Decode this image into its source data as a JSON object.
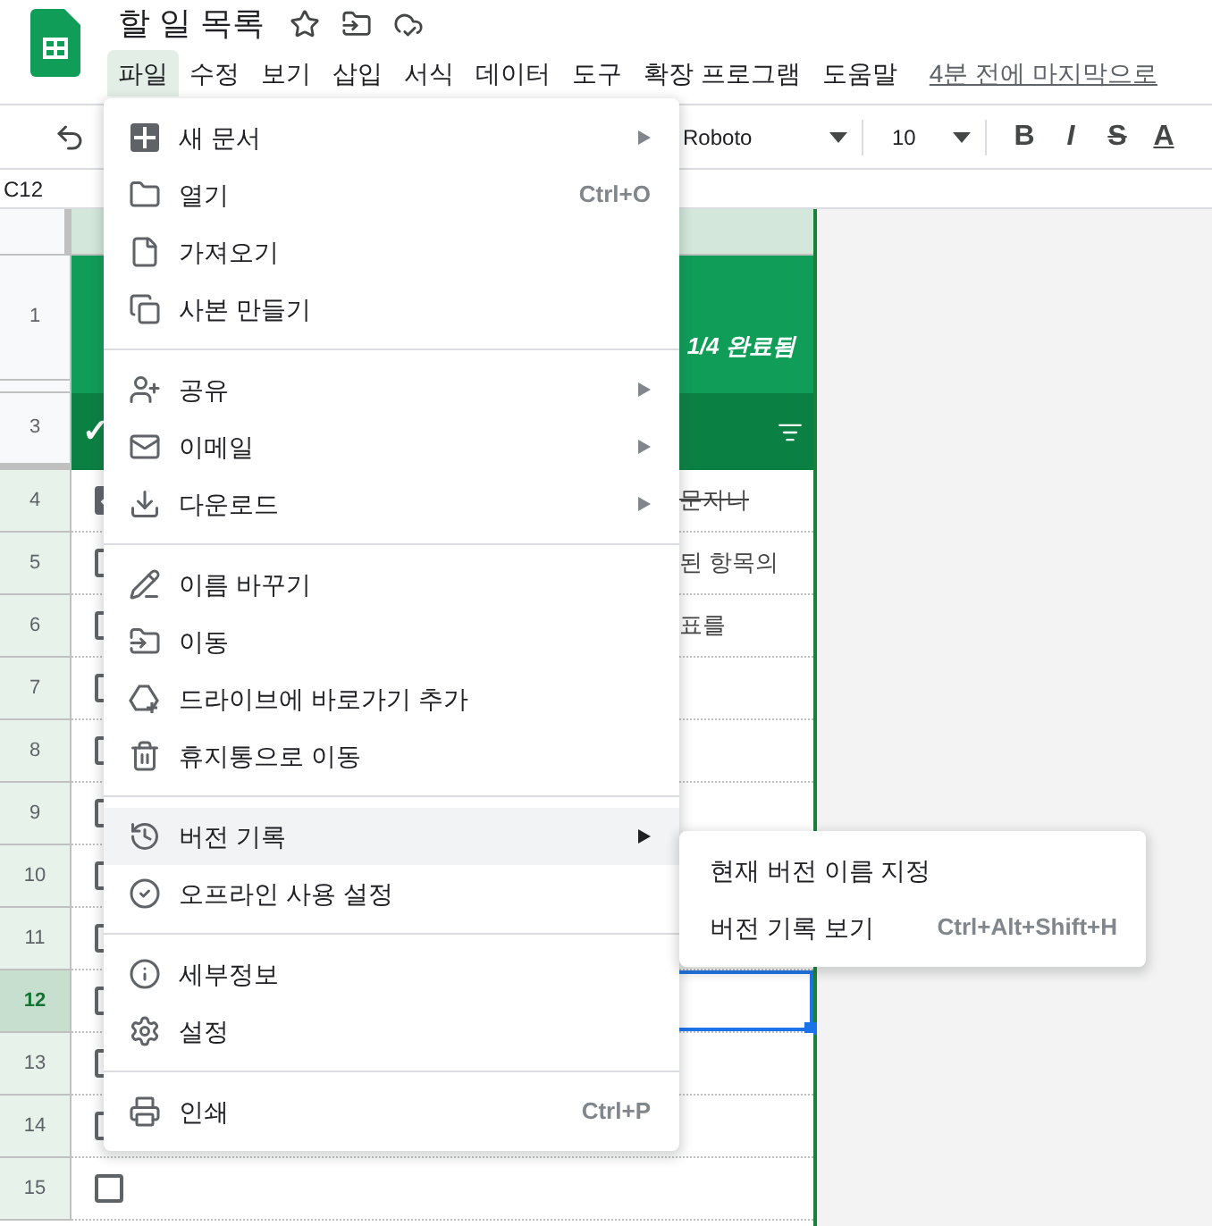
{
  "app": {
    "title": "할 일 목록",
    "menubar": [
      {
        "label": "파일",
        "selected": true
      },
      {
        "label": "수정",
        "selected": false
      },
      {
        "label": "보기",
        "selected": false
      },
      {
        "label": "삽입",
        "selected": false
      },
      {
        "label": "서식",
        "selected": false
      },
      {
        "label": "데이터",
        "selected": false
      },
      {
        "label": "도구",
        "selected": false
      },
      {
        "label": "확장 프로그램",
        "selected": false
      },
      {
        "label": "도움말",
        "selected": false
      }
    ],
    "last_edit": "4분 전에 마지막으로"
  },
  "toolbar": {
    "font": "Roboto",
    "font_size": "10",
    "format_buttons": [
      "B",
      "I",
      "S",
      "A"
    ]
  },
  "name_box": "C12",
  "sheet": {
    "rows": [
      {
        "number": "1",
        "kind": "title",
        "progress": "1/4 완료됨"
      },
      {
        "kind": "spacer"
      },
      {
        "number": "3",
        "kind": "header",
        "check_mark": "✓"
      },
      {
        "number": "4",
        "kind": "task",
        "selected": false,
        "checked": true,
        "text": "문자나"
      },
      {
        "number": "5",
        "kind": "task",
        "selected": false,
        "checked": false,
        "text": "된 항목의"
      },
      {
        "number": "6",
        "kind": "task",
        "selected": false,
        "checked": false,
        "text": "표를"
      },
      {
        "number": "7",
        "kind": "task",
        "selected": false,
        "checked": false
      },
      {
        "number": "8",
        "kind": "task",
        "selected": false,
        "checked": false
      },
      {
        "number": "9",
        "kind": "task",
        "selected": false,
        "checked": false
      },
      {
        "number": "10",
        "kind": "task",
        "selected": false,
        "checked": false
      },
      {
        "number": "11",
        "kind": "task",
        "selected": false,
        "checked": false
      },
      {
        "number": "12",
        "kind": "task",
        "selected": true,
        "checked": false
      },
      {
        "number": "13",
        "kind": "task",
        "selected": false,
        "checked": false
      },
      {
        "number": "14",
        "kind": "task",
        "selected": false,
        "checked": false
      },
      {
        "number": "15",
        "kind": "task",
        "selected": false,
        "checked": false
      }
    ]
  },
  "file_menu": {
    "groups": [
      [
        {
          "label": "새 문서",
          "submenu": true,
          "selected": false
        },
        {
          "label": "열기",
          "shortcut": "Ctrl+O",
          "submenu": false,
          "selected": false
        },
        {
          "label": "가져오기",
          "submenu": false,
          "selected": false
        },
        {
          "label": "사본 만들기",
          "submenu": false,
          "selected": false
        }
      ],
      [
        {
          "label": "공유",
          "submenu": true,
          "selected": false
        },
        {
          "label": "이메일",
          "submenu": true,
          "selected": false
        },
        {
          "label": "다운로드",
          "submenu": true,
          "selected": false
        }
      ],
      [
        {
          "label": "이름 바꾸기",
          "submenu": false,
          "selected": false
        },
        {
          "label": "이동",
          "submenu": false,
          "selected": false
        },
        {
          "label": "드라이브에 바로가기 추가",
          "submenu": false,
          "selected": false
        },
        {
          "label": "휴지통으로 이동",
          "submenu": false,
          "selected": false
        }
      ],
      [
        {
          "label": "버전 기록",
          "submenu": true,
          "selected": true
        },
        {
          "label": "오프라인 사용 설정",
          "submenu": false,
          "selected": false
        }
      ],
      [
        {
          "label": "세부정보",
          "submenu": false,
          "selected": false
        },
        {
          "label": "설정",
          "submenu": false,
          "selected": false
        }
      ],
      [
        {
          "label": "인쇄",
          "shortcut": "Ctrl+P",
          "submenu": false,
          "selected": false
        }
      ]
    ]
  },
  "version_submenu": [
    {
      "label": "현재 버전 이름 지정"
    },
    {
      "label": "버전 기록 보기",
      "shortcut": "Ctrl+Alt+Shift+H"
    }
  ]
}
